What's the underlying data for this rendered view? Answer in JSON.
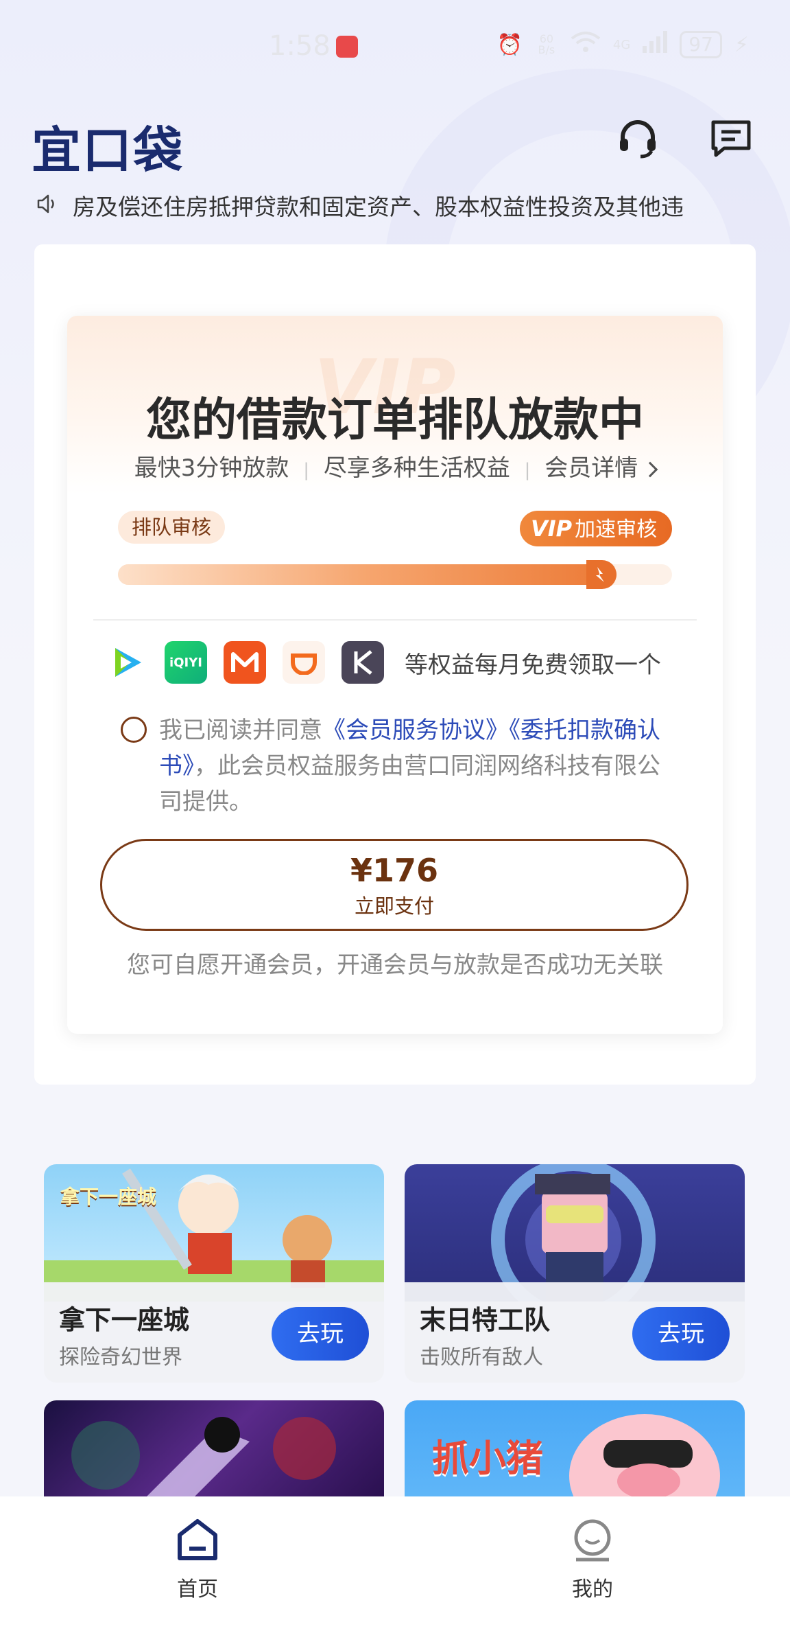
{
  "status_bar": {
    "time": "1:58",
    "speed": "60 B/s",
    "network": "4G",
    "battery": "97"
  },
  "header": {
    "logo": "宜口袋",
    "support_icon": "headset-icon",
    "message_icon": "message-icon"
  },
  "notice": {
    "icon": "speaker-icon",
    "text": "房及偿还住房抵押贷款和固定资产、股本权益性投资及其他违"
  },
  "order": {
    "watermark": "VIP",
    "title": "您的借款订单排队放款中",
    "subtitle_items": [
      "最快3分钟放款",
      "尽享多种生活权益",
      "会员详情"
    ],
    "queue_label": "排队审核",
    "vip_badge_mark": "VIP",
    "vip_label": "加速审核",
    "progress": 0.9,
    "benefits_text": "等权益每月免费领取一个",
    "benefit_icons": [
      "tencent-video-icon",
      "iqiyi-icon",
      "mango-tv-icon",
      "didi-icon",
      "k-app-icon"
    ],
    "agree_prefix": "我已阅读并同意",
    "agree_link1": "《会员服务协议》",
    "agree_link2": "《委托扣款确认书》",
    "agree_suffix": "，此会员权益服务由营口同润网络科技有限公司提供。",
    "price": "¥176",
    "pay_label": "立即支付",
    "note": "您可自愿开通会员，开通会员与放款是否成功无关联"
  },
  "games": [
    {
      "name": "拿下一座城",
      "desc": "探险奇幻世界",
      "button": "去玩",
      "art_text": "拿下一座城"
    },
    {
      "name": "末日特工队",
      "desc": "击败所有敌人",
      "button": "去玩",
      "art_text": ""
    },
    {
      "name": "",
      "desc": "",
      "button": "",
      "art_text": ""
    },
    {
      "name": "",
      "desc": "",
      "button": "",
      "art_text": "抓小猪"
    }
  ],
  "bottom_nav": [
    {
      "label": "首页",
      "icon": "home-icon",
      "active": true
    },
    {
      "label": "我的",
      "icon": "profile-icon",
      "active": false
    }
  ],
  "colors": {
    "brand_navy": "#1a2b6e",
    "accent_orange": "#e8702c",
    "pay_brown": "#7a3a16",
    "link_blue": "#2c4bb8",
    "play_blue": "#2456dc"
  }
}
